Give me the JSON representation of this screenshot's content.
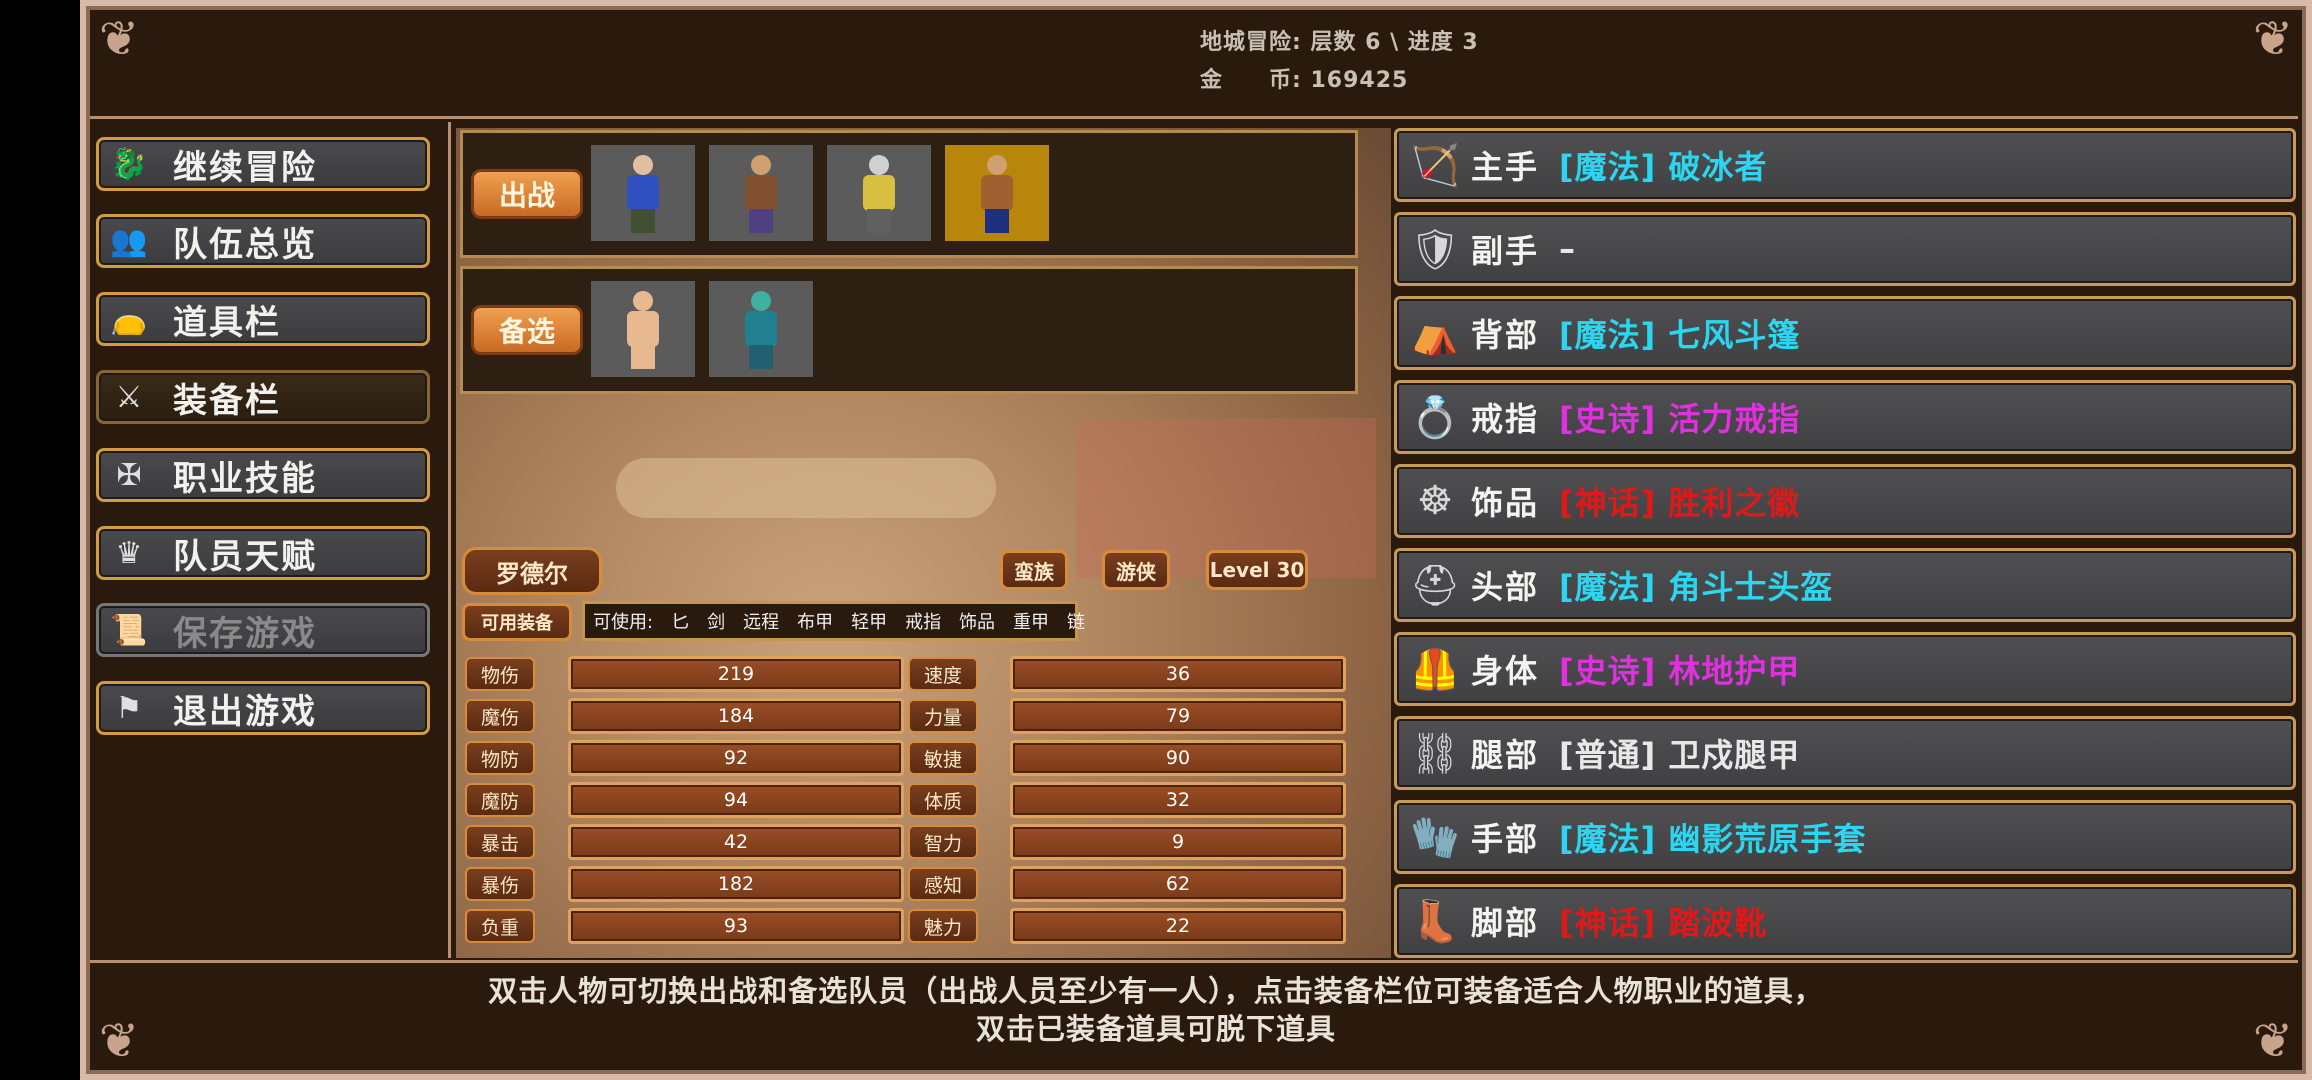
{
  "colors": {
    "magic": "#2cd6f0",
    "epic": "#e030e0",
    "myth": "#e01818",
    "common": "#e8e8e8",
    "accent": "#d69a3e"
  },
  "header": {
    "dungeon": "地城冒险: 层数 6 \\ 进度 3",
    "gold": "金　　币: 169425"
  },
  "menu": [
    {
      "label": "继续冒险",
      "icon": "dragon-icon"
    },
    {
      "label": "队伍总览",
      "icon": "party-icon"
    },
    {
      "label": "道具栏",
      "icon": "bag-icon"
    },
    {
      "label": "装备栏",
      "icon": "equipment-icon",
      "active": true
    },
    {
      "label": "职业技能",
      "icon": "skill-icon"
    },
    {
      "label": "队员天赋",
      "icon": "talent-icon"
    },
    {
      "label": "保存游戏",
      "icon": "scroll-icon",
      "disabled": true
    },
    {
      "label": "退出游戏",
      "icon": "flag-icon"
    }
  ],
  "team": {
    "active_label": "出战",
    "reserve_label": "备选",
    "active": [
      {
        "name": "hero-1",
        "selected": false
      },
      {
        "name": "hero-2",
        "selected": false
      },
      {
        "name": "hero-3",
        "selected": false
      },
      {
        "name": "hero-4",
        "selected": true
      }
    ],
    "reserve": [
      {
        "name": "reserve-1"
      },
      {
        "name": "reserve-2"
      }
    ]
  },
  "character": {
    "name": "罗德尔",
    "race": "蛮族",
    "class": "游侠",
    "level": "Level 30",
    "usable_label": "可用装备",
    "usable_text": "可使用:　匕　剑　远程　布甲　轻甲　戒指　饰品　重甲　链"
  },
  "stats_left": [
    {
      "label": "物伤",
      "value": "219"
    },
    {
      "label": "魔伤",
      "value": "184"
    },
    {
      "label": "物防",
      "value": "92"
    },
    {
      "label": "魔防",
      "value": "94"
    },
    {
      "label": "暴击",
      "value": "42"
    },
    {
      "label": "暴伤",
      "value": "182"
    },
    {
      "label": "负重",
      "value": "93"
    }
  ],
  "stats_right": [
    {
      "label": "速度",
      "value": "36"
    },
    {
      "label": "力量",
      "value": "79"
    },
    {
      "label": "敏捷",
      "value": "90"
    },
    {
      "label": "体质",
      "value": "32"
    },
    {
      "label": "智力",
      "value": "9"
    },
    {
      "label": "感知",
      "value": "62"
    },
    {
      "label": "魅力",
      "value": "22"
    }
  ],
  "equipment": [
    {
      "slot": "主手",
      "item": "[魔法] 破冰者",
      "rarity": "magic",
      "icon": "bow-icon"
    },
    {
      "slot": "副手",
      "item": "–",
      "rarity": "common",
      "icon": "shield-icon"
    },
    {
      "slot": "背部",
      "item": "[魔法] 七风斗篷",
      "rarity": "magic",
      "icon": "cloak-icon"
    },
    {
      "slot": "戒指",
      "item": "[史诗] 活力戒指",
      "rarity": "epic",
      "icon": "ring-icon"
    },
    {
      "slot": "饰品",
      "item": "[神话] 胜利之徽",
      "rarity": "myth",
      "icon": "amulet-icon"
    },
    {
      "slot": "头部",
      "item": "[魔法] 角斗士头盔",
      "rarity": "magic",
      "icon": "helmet-icon"
    },
    {
      "slot": "身体",
      "item": "[史诗] 林地护甲",
      "rarity": "epic",
      "icon": "armor-icon"
    },
    {
      "slot": "腿部",
      "item": "[普通] 卫戍腿甲",
      "rarity": "common",
      "icon": "greaves-icon"
    },
    {
      "slot": "手部",
      "item": "[魔法] 幽影荒原手套",
      "rarity": "magic",
      "icon": "gloves-icon"
    },
    {
      "slot": "脚部",
      "item": "[神话] 踏波靴",
      "rarity": "myth",
      "icon": "boots-icon"
    }
  ],
  "footer": {
    "line1": "双击人物可切换出战和备选队员（出战人员至少有一人），点击装备栏位可装备适合人物职业的道具，",
    "line2": "双击已装备道具可脱下道具"
  }
}
